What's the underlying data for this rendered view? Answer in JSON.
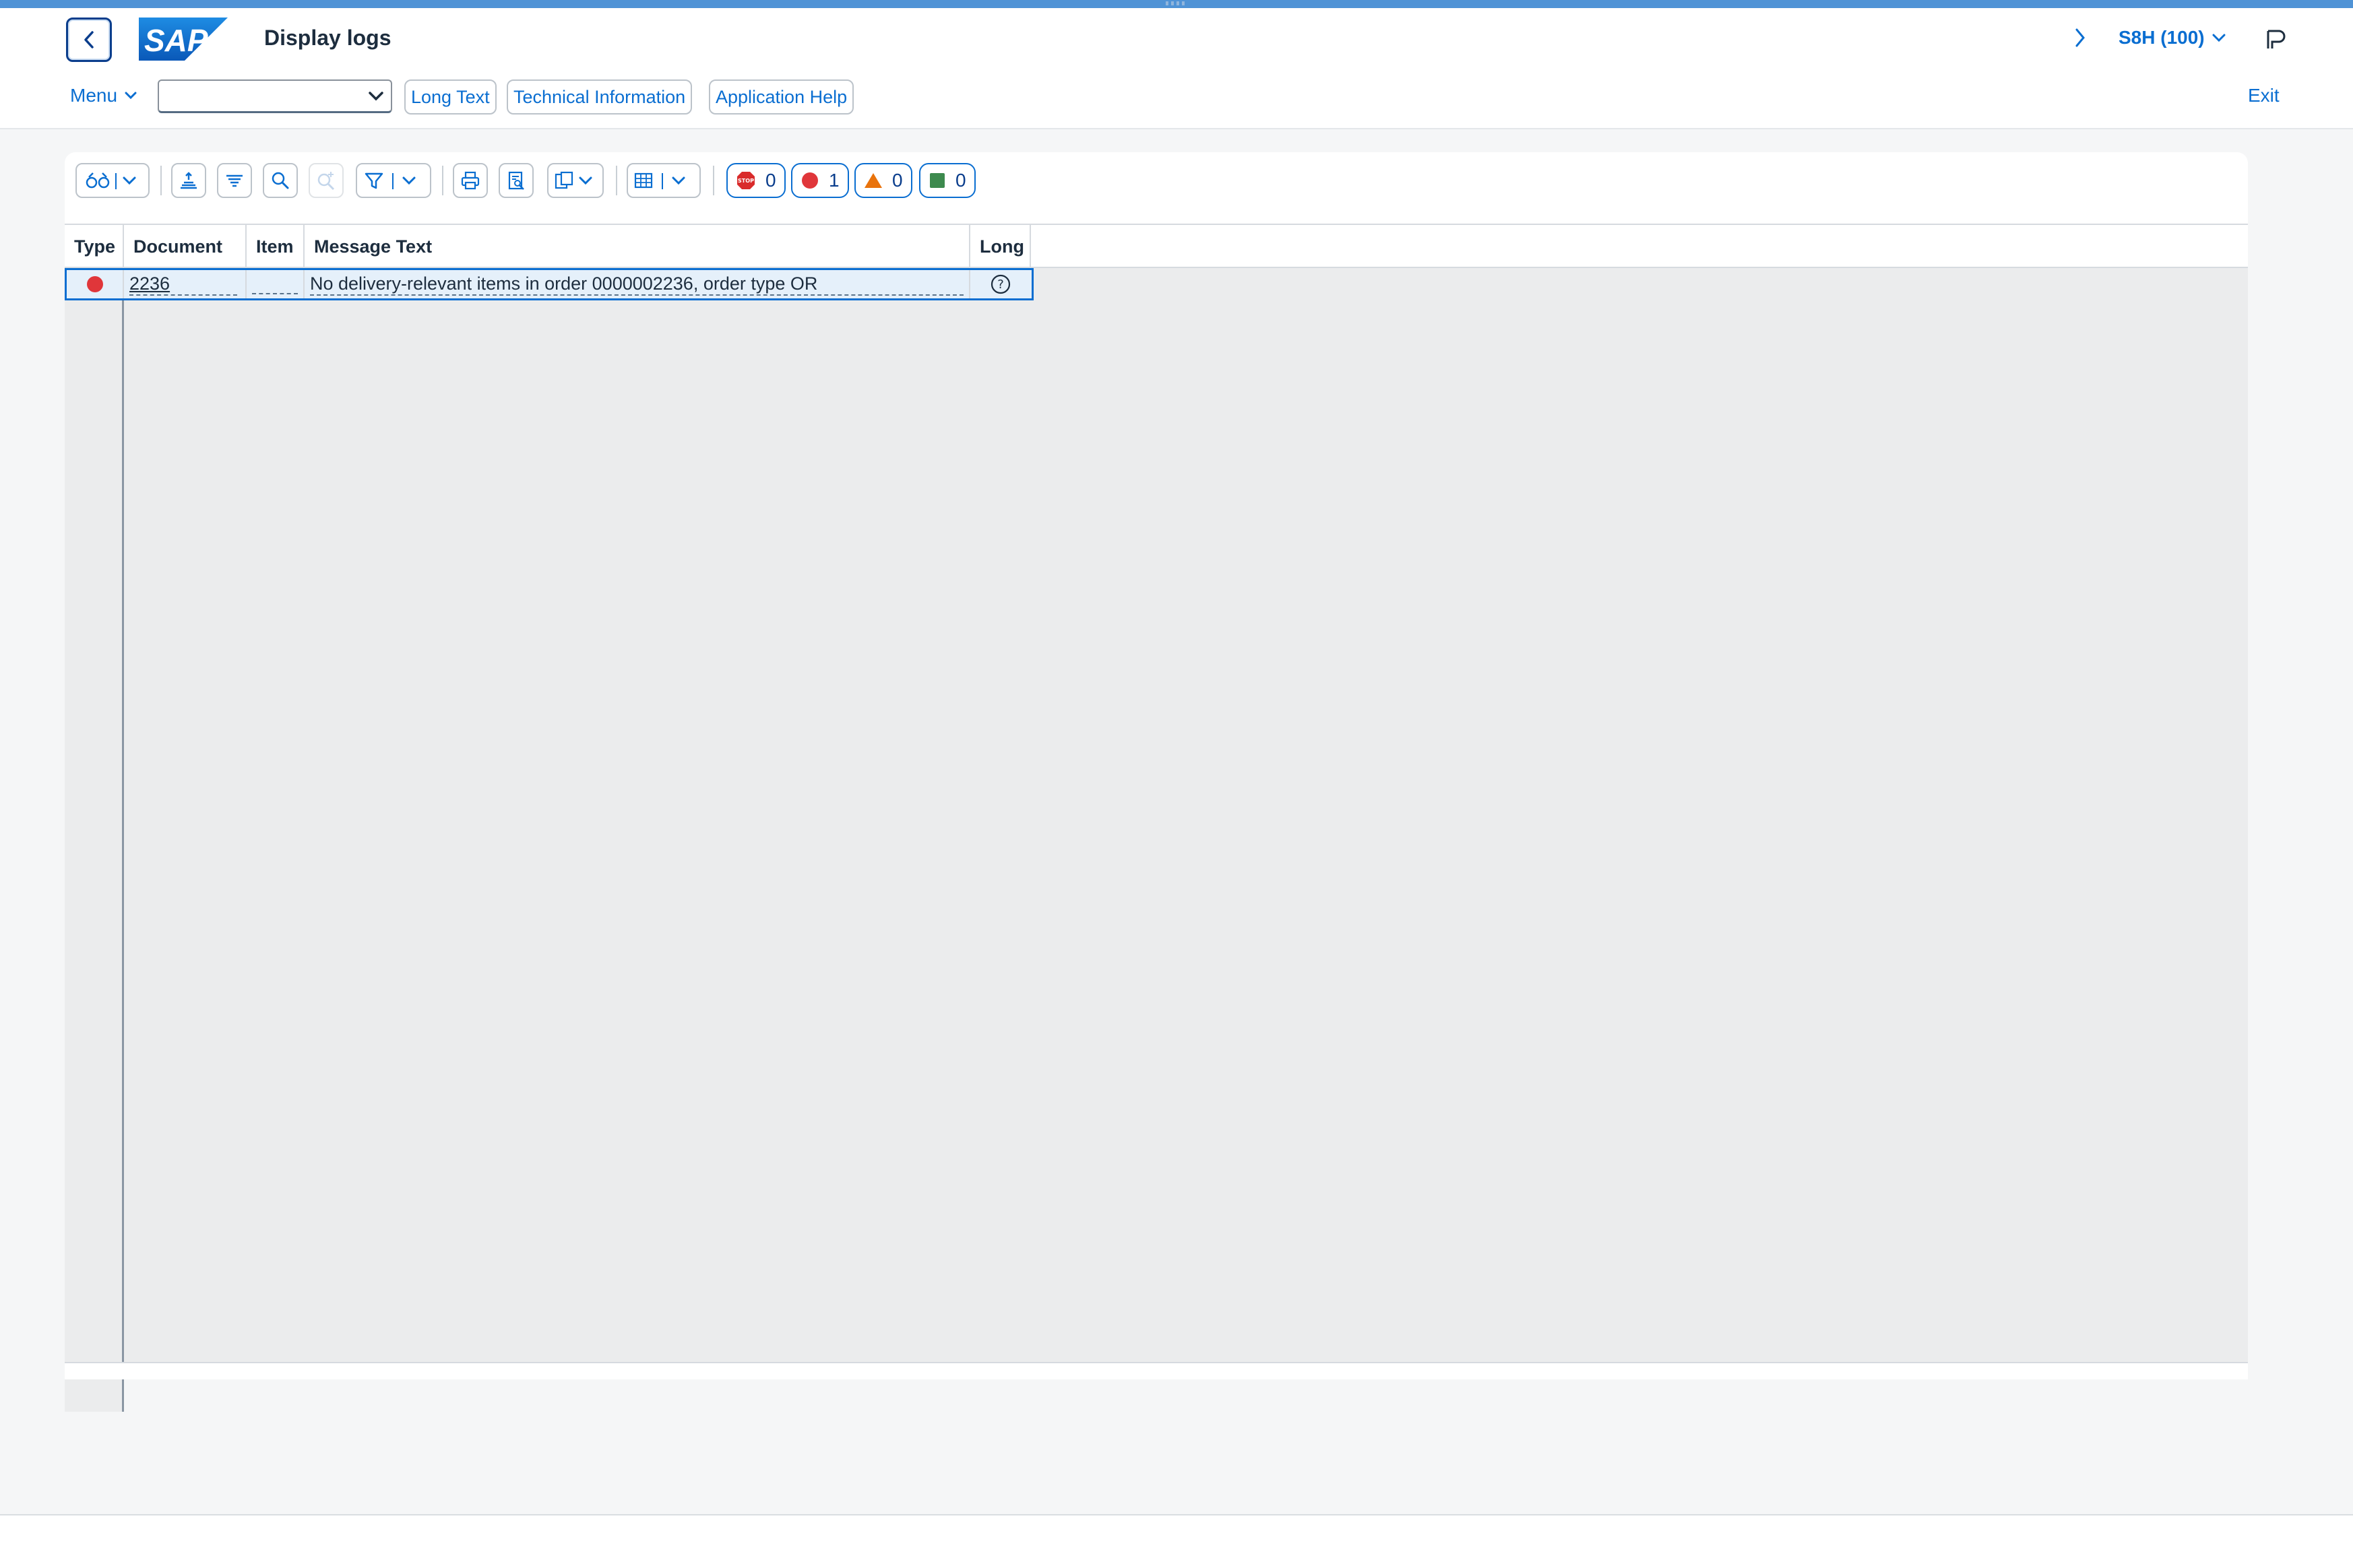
{
  "shell": {
    "title": "Display logs",
    "logo_text": "SAP",
    "system": "S8H (100)"
  },
  "toolbar": {
    "menu_label": "Menu",
    "command_value": "",
    "buttons": [
      "Long Text",
      "Technical Information",
      "Application Help"
    ],
    "exit_label": "Exit"
  },
  "alv": {
    "icons": [
      "details-icon",
      "sort-ascending-icon",
      "sort-descending-icon",
      "find-icon",
      "find-next-icon",
      "filter-icon",
      "print-icon",
      "print-preview-icon",
      "export-icon",
      "layout-grid-icon"
    ],
    "counters": {
      "stop": "0",
      "error": "1",
      "warning": "0",
      "success": "0"
    },
    "colors": {
      "stop": "#d92b2b",
      "error": "#e0363a",
      "warning": "#e9730c",
      "success": "#3d8a4e",
      "accent": "#0a6ed1"
    },
    "columns": [
      "Type",
      "Document",
      "Item",
      "Message Text",
      "Long"
    ],
    "rows": [
      {
        "type": "error",
        "document": "2236",
        "item": "",
        "message": "No delivery-relevant items in order 0000002236, order type OR",
        "long": "help-icon"
      }
    ]
  }
}
